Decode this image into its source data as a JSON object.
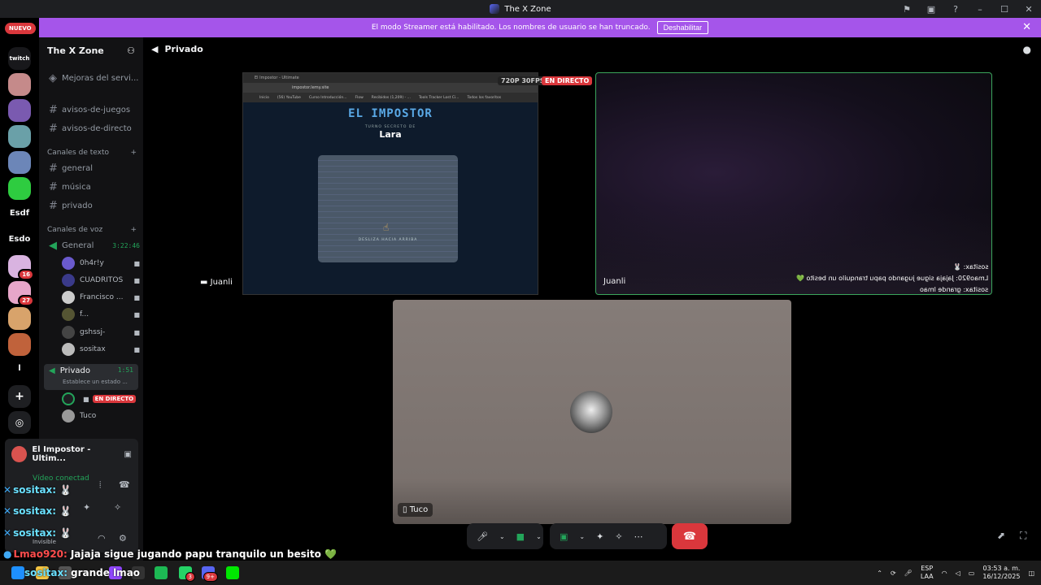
{
  "window": {
    "title": "The X Zone"
  },
  "banner": {
    "text": "El modo Streamer está habilitado. Los nombres de usuario se han truncado.",
    "button": "Deshabilitar"
  },
  "guilds": {
    "nuevo": "NUEVO",
    "twitch": "twitch",
    "badge1": "16",
    "badge2": "27",
    "esdf": "Esdf",
    "esdo": "Esdo",
    "l": "l"
  },
  "server": {
    "name": "The X Zone",
    "top_items": [
      "Mejoras del servi...",
      "avisos-de-juegos",
      "avisos-de-directo"
    ],
    "text_category": "Canales de texto",
    "text_channels": [
      "general",
      "música",
      "privado"
    ],
    "voice_category": "Canales de voz",
    "general_voice": {
      "name": "General",
      "time": "3:22:46"
    },
    "voice_users": [
      "0h4r!y",
      "CUADRITOS",
      "Francisco ...",
      "f...",
      "gshssj-",
      "sositax"
    ],
    "private_voice": {
      "name": "Privado",
      "time": "1:51",
      "status": "Establece un estado ..."
    },
    "private_live": "EN DIRECTO",
    "private_user2": "Tuco"
  },
  "panel": {
    "activity": "El Impostor - Ultim...",
    "video": "Vídeo conectad",
    "status": "Invisible"
  },
  "stage": {
    "channel": "Privado",
    "tile1_label": "Juanli",
    "tile2_label": "Juanli",
    "tile3_label": "Tuco",
    "quality": "720P 30FPS",
    "live": "EN DIRECTO"
  },
  "shared_screen": {
    "tab": "El Impostor - Ultimate",
    "url": "impostor.lemy.site",
    "bookmarks": [
      "Inicio",
      "(56) YouTube",
      "Curso Introducción...",
      "Flow",
      "Recibidos (1,209) - ...",
      "Tools Tracker Lost Ci...",
      "Todos los favoritos"
    ],
    "title": "EL IMPOSTOR",
    "subtitle": "TURNO SECRETO DE",
    "name": "Lara",
    "hint": "DESLIZA HACIA ARRIBA"
  },
  "overlay_chat": [
    "sositax: 🐰",
    "Lmao920: Jajaja sigue jugando papu tranquilo un besito 💚",
    "sositax: grande lmao"
  ],
  "stream_chat": [
    {
      "name": "sositax:",
      "msg": "🐰"
    },
    {
      "name": "sositax:",
      "msg": "🐰"
    },
    {
      "name": "sositax:",
      "msg": "🐰"
    },
    {
      "name": "Lmao920:",
      "msg": "Jajaja sigue jugando papu tranquilo un besito 💚"
    },
    {
      "name": "sositax:",
      "msg": "grande lmao"
    }
  ],
  "taskbar": {
    "lang": "ESP",
    "layout": "LAA",
    "time": "03:53 a. m.",
    "date": "16/12/2025",
    "badge_whatsapp": "3",
    "badge_discord": "9+"
  },
  "colors": {
    "accent": "#a555ea",
    "danger": "#da373c",
    "online": "#23a55a"
  }
}
